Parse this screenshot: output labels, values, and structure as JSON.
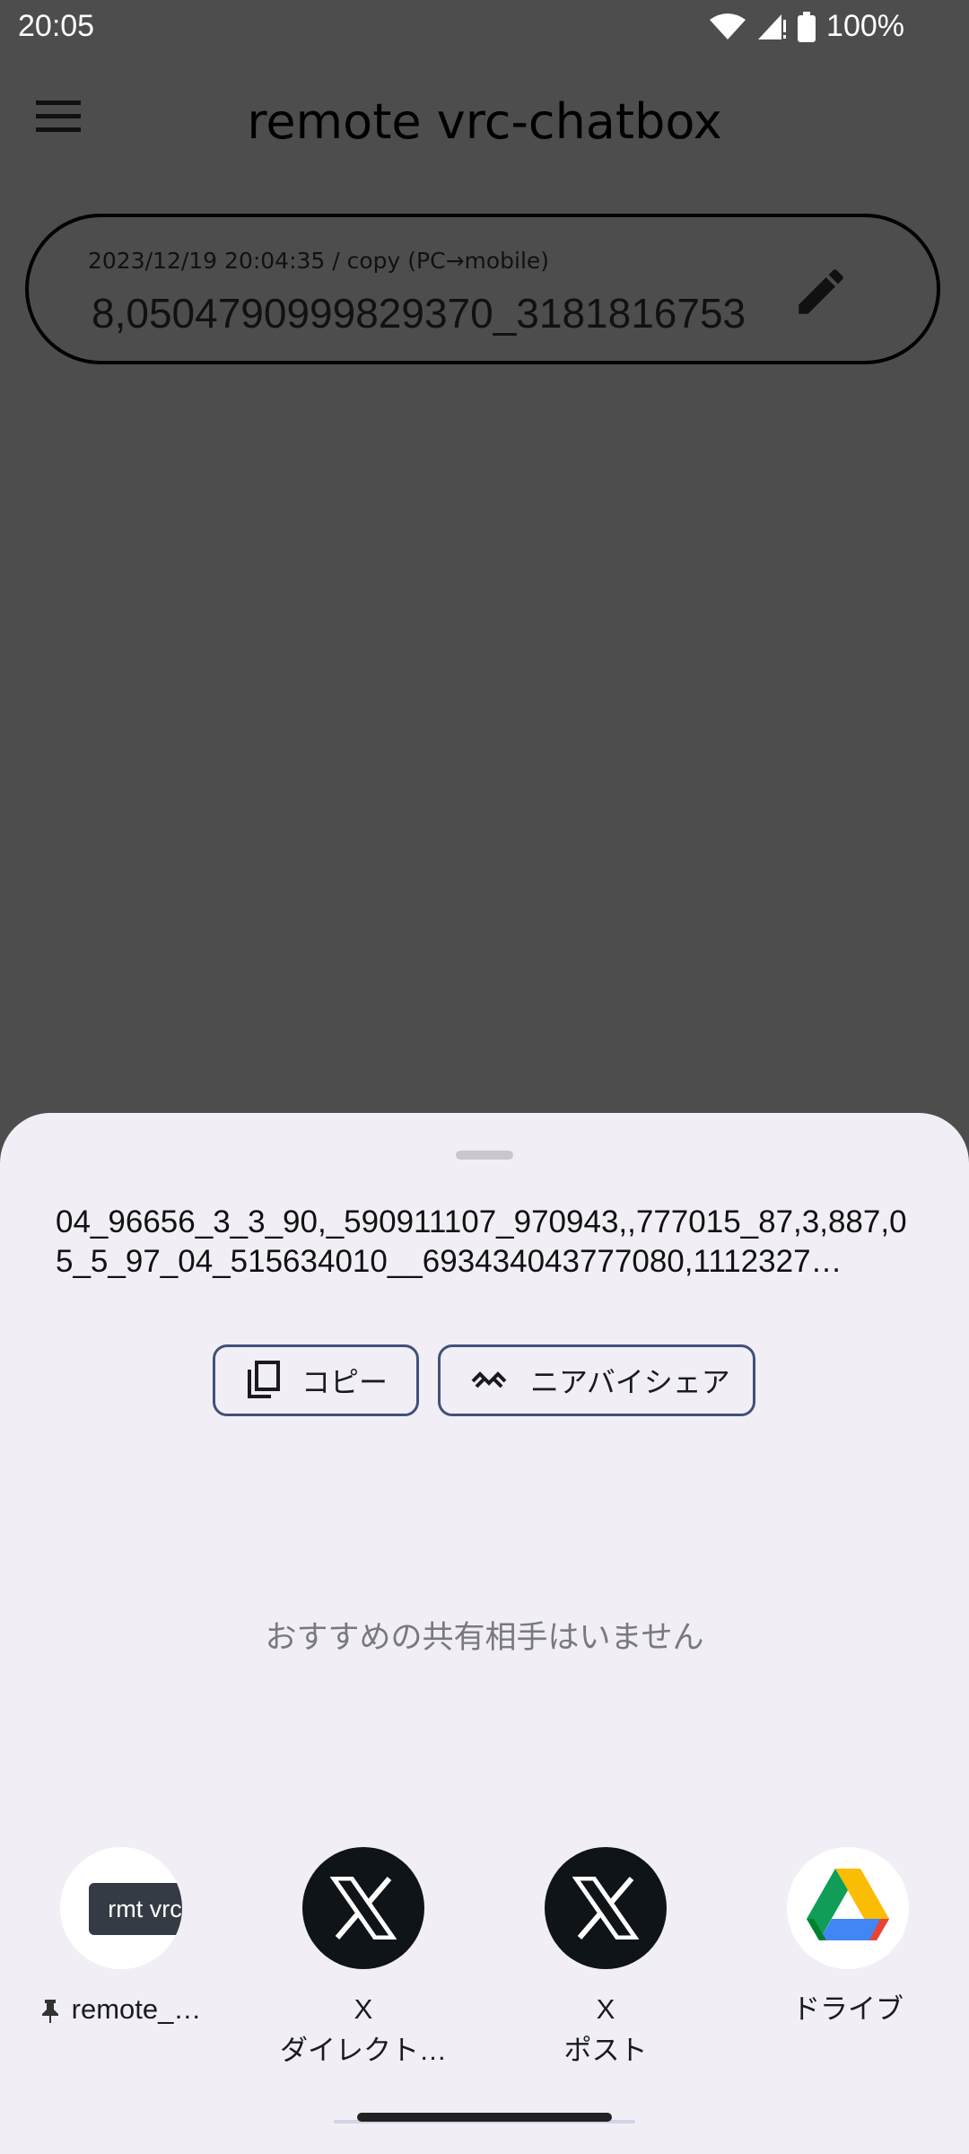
{
  "status_bar": {
    "time": "20:05",
    "battery": "100%"
  },
  "app_bar": {
    "title": "remote vrc-chatbox"
  },
  "card": {
    "meta": "2023/12/19 20:04:35 / copy (PC→mobile)",
    "text": "8,0504790999829370_3181816753"
  },
  "share_sheet": {
    "preview_text": "04_96656_3_3_90,_590911107_970943,,777015_87,3,887,05_5_97_04_515634010__693434043777080,1112327…",
    "copy_label": "コピー",
    "nearby_label": "ニアバイシェア",
    "no_suggestions": "おすすめの共有相手はいません",
    "apps": [
      {
        "line1": "remote_…",
        "line2": "",
        "icon": "app-thumbnail-icon",
        "badge": "rmt vrc c"
      },
      {
        "line1": "X",
        "line2": "ダイレクト…",
        "icon": "x-logo-icon"
      },
      {
        "line1": "X",
        "line2": "ポスト",
        "icon": "x-logo-icon"
      },
      {
        "line1": "ドライブ",
        "line2": "",
        "icon": "google-drive-icon"
      }
    ]
  },
  "colors": {
    "scrim": "#4d4d4d",
    "sheet_bg": "#f1eff5",
    "chip_border": "#44507a",
    "x_bg": "#0f1419"
  }
}
